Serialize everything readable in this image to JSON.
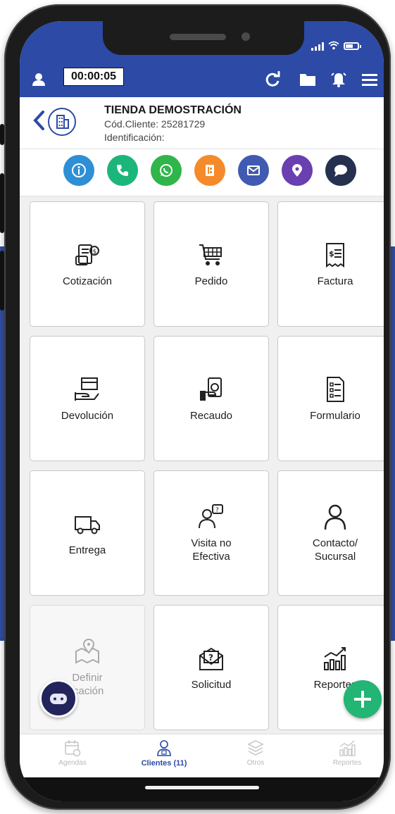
{
  "toolbar": {
    "timer": "00:00:05"
  },
  "client": {
    "name": "TIENDA DEMOSTRACIÓN",
    "code": "Cód.Cliente: 25281729",
    "identification": "Identificación:"
  },
  "actions": [
    {
      "icon": "info-icon",
      "color": "#2e8fd6"
    },
    {
      "icon": "phone-icon",
      "color": "#1db67a"
    },
    {
      "icon": "whatsapp-icon",
      "color": "#2fb54a"
    },
    {
      "icon": "document-icon",
      "color": "#f58a2a"
    },
    {
      "icon": "mail-icon",
      "color": "#3f5ab0"
    },
    {
      "icon": "location-icon",
      "color": "#6a3fb0"
    },
    {
      "icon": "chat-icon",
      "color": "#25314f"
    }
  ],
  "tiles": [
    {
      "label": "Cotización",
      "icon": "quote-icon"
    },
    {
      "label": "Pedido",
      "icon": "cart-icon"
    },
    {
      "label": "Factura",
      "icon": "invoice-icon"
    },
    {
      "label": "Devolución",
      "icon": "return-icon"
    },
    {
      "label": "Recaudo",
      "icon": "cash-icon"
    },
    {
      "label": "Formulario",
      "icon": "form-icon"
    },
    {
      "label": "Entrega",
      "icon": "truck-icon"
    },
    {
      "label": "Visita no\nEfectiva",
      "icon": "visit-icon"
    },
    {
      "label": "Contacto/\nSucursal",
      "icon": "contact-icon"
    },
    {
      "label": "Definir\nicación",
      "icon": "map-pin-icon",
      "disabled": true
    },
    {
      "label": "Solicitud",
      "icon": "request-icon"
    },
    {
      "label": "Reportes",
      "icon": "reports-icon"
    }
  ],
  "bottom_nav": [
    {
      "label": "Agendas",
      "icon": "calendar-icon",
      "active": false
    },
    {
      "label": "Clientes (11)",
      "icon": "clients-icon",
      "active": true
    },
    {
      "label": "Otros",
      "icon": "layers-icon",
      "active": false
    },
    {
      "label": "Reportes",
      "icon": "bar-chart-icon",
      "active": false
    }
  ],
  "colors": {
    "primary": "#2c4aa6",
    "fab_add": "#22b573",
    "bot": "#24245c"
  }
}
